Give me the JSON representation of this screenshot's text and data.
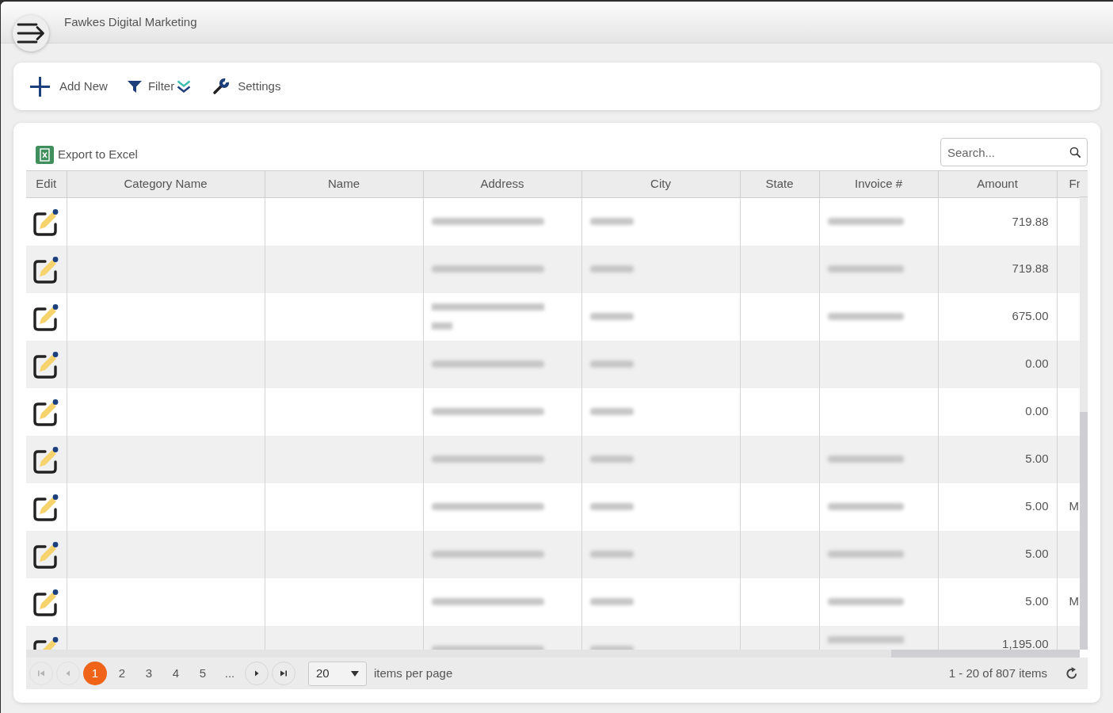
{
  "header": {
    "title": "Fawkes Digital Marketing"
  },
  "toolbar": [
    {
      "kind": "add",
      "label": "Add New"
    },
    {
      "kind": "filter",
      "label": "Filter"
    },
    {
      "kind": "settings",
      "label": "Settings"
    }
  ],
  "grid": {
    "export_label": "Export to Excel",
    "search": {
      "placeholder": "Search..."
    },
    "columns": [
      {
        "label": "Edit"
      },
      {
        "label": "Category Name"
      },
      {
        "label": "Name"
      },
      {
        "label": "Address"
      },
      {
        "label": "City"
      },
      {
        "label": "State"
      },
      {
        "label": "Invoice #"
      },
      {
        "label": "Amount"
      },
      {
        "label": "Fr"
      }
    ],
    "rows": [
      {
        "cells": [
          {
            "kind": "edit"
          },
          {
            "kind": "empty"
          },
          {
            "kind": "empty"
          },
          {
            "kind": "blurred",
            "wrapped": false
          },
          {
            "kind": "blurred",
            "wrapped": false
          },
          {
            "kind": "empty"
          },
          {
            "kind": "blurred",
            "wrapped": false
          },
          {
            "kind": "number",
            "text": "719.88"
          },
          {
            "kind": "empty"
          }
        ]
      },
      {
        "cells": [
          {
            "kind": "edit"
          },
          {
            "kind": "empty"
          },
          {
            "kind": "empty"
          },
          {
            "kind": "blurred",
            "wrapped": false
          },
          {
            "kind": "blurred",
            "wrapped": false
          },
          {
            "kind": "empty"
          },
          {
            "kind": "blurred",
            "wrapped": false
          },
          {
            "kind": "number",
            "text": "719.88"
          },
          {
            "kind": "empty"
          }
        ]
      },
      {
        "cells": [
          {
            "kind": "edit"
          },
          {
            "kind": "empty"
          },
          {
            "kind": "empty"
          },
          {
            "kind": "blurred",
            "wrapped": true
          },
          {
            "kind": "blurred",
            "wrapped": false
          },
          {
            "kind": "empty"
          },
          {
            "kind": "blurred",
            "wrapped": false
          },
          {
            "kind": "number",
            "text": "675.00"
          },
          {
            "kind": "empty"
          }
        ]
      },
      {
        "cells": [
          {
            "kind": "edit"
          },
          {
            "kind": "empty"
          },
          {
            "kind": "empty"
          },
          {
            "kind": "blurred",
            "wrapped": false
          },
          {
            "kind": "blurred",
            "wrapped": false
          },
          {
            "kind": "empty"
          },
          {
            "kind": "empty"
          },
          {
            "kind": "number",
            "text": "0.00"
          },
          {
            "kind": "empty"
          }
        ]
      },
      {
        "cells": [
          {
            "kind": "edit"
          },
          {
            "kind": "empty"
          },
          {
            "kind": "empty"
          },
          {
            "kind": "blurred",
            "wrapped": false
          },
          {
            "kind": "blurred",
            "wrapped": false
          },
          {
            "kind": "empty"
          },
          {
            "kind": "empty"
          },
          {
            "kind": "number",
            "text": "0.00"
          },
          {
            "kind": "empty"
          }
        ]
      },
      {
        "cells": [
          {
            "kind": "edit"
          },
          {
            "kind": "empty"
          },
          {
            "kind": "empty"
          },
          {
            "kind": "blurred",
            "wrapped": false
          },
          {
            "kind": "blurred",
            "wrapped": false
          },
          {
            "kind": "empty"
          },
          {
            "kind": "blurred",
            "wrapped": false
          },
          {
            "kind": "number",
            "text": "5.00"
          },
          {
            "kind": "empty"
          }
        ]
      },
      {
        "cells": [
          {
            "kind": "edit"
          },
          {
            "kind": "empty"
          },
          {
            "kind": "empty"
          },
          {
            "kind": "blurred",
            "wrapped": false
          },
          {
            "kind": "blurred",
            "wrapped": false
          },
          {
            "kind": "empty"
          },
          {
            "kind": "blurred",
            "wrapped": false
          },
          {
            "kind": "number",
            "text": "5.00"
          },
          {
            "kind": "text",
            "text": "M"
          }
        ]
      },
      {
        "cells": [
          {
            "kind": "edit"
          },
          {
            "kind": "empty"
          },
          {
            "kind": "empty"
          },
          {
            "kind": "blurred",
            "wrapped": false
          },
          {
            "kind": "blurred",
            "wrapped": false
          },
          {
            "kind": "empty"
          },
          {
            "kind": "blurred",
            "wrapped": false
          },
          {
            "kind": "number",
            "text": "5.00"
          },
          {
            "kind": "empty"
          }
        ]
      },
      {
        "cells": [
          {
            "kind": "edit"
          },
          {
            "kind": "empty"
          },
          {
            "kind": "empty"
          },
          {
            "kind": "blurred",
            "wrapped": false
          },
          {
            "kind": "blurred",
            "wrapped": false
          },
          {
            "kind": "empty"
          },
          {
            "kind": "blurred",
            "wrapped": false
          },
          {
            "kind": "number",
            "text": "5.00"
          },
          {
            "kind": "text",
            "text": "M"
          }
        ]
      },
      {
        "cells": [
          {
            "kind": "edit"
          },
          {
            "kind": "empty"
          },
          {
            "kind": "empty"
          },
          {
            "kind": "blurred",
            "wrapped": false
          },
          {
            "kind": "blurred",
            "wrapped": false
          },
          {
            "kind": "empty"
          },
          {
            "kind": "blurred",
            "wrapped": true
          },
          {
            "kind": "number",
            "text": "1,195.00"
          },
          {
            "kind": "empty"
          }
        ]
      }
    ],
    "pager": {
      "nav": [
        {
          "kind": "first",
          "disabled": true
        },
        {
          "kind": "prev",
          "disabled": true
        },
        {
          "kind": "next",
          "disabled": false
        },
        {
          "kind": "last",
          "disabled": false
        }
      ],
      "pages": [
        {
          "label": "1",
          "selected": true
        },
        {
          "label": "2",
          "selected": false
        },
        {
          "label": "3",
          "selected": false
        },
        {
          "label": "4",
          "selected": false
        },
        {
          "label": "5",
          "selected": false
        }
      ],
      "more": "...",
      "page_size": "20",
      "page_size_label": "items per page",
      "summary": "1 - 20 of 807 items"
    }
  }
}
